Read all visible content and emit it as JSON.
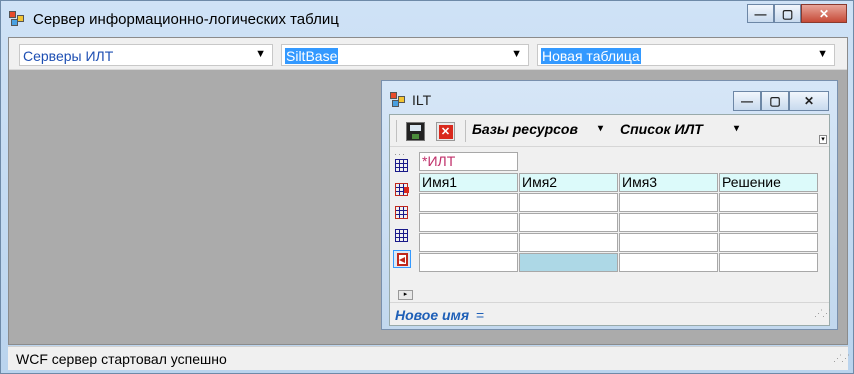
{
  "main_window": {
    "title": "Сервер информационно-логических таблиц",
    "caption_buttons": {
      "minimize": "—",
      "maximize": "▢",
      "close": "✕"
    }
  },
  "toolbar": {
    "combos": [
      {
        "value": "Серверы ИЛТ",
        "selected": false
      },
      {
        "value": "SiltBase",
        "selected": true
      },
      {
        "value": "Новая таблица",
        "selected": true
      }
    ],
    "dropdown_arrow": "▼"
  },
  "status_bar": {
    "text": "WCF сервер стартовал успешно"
  },
  "child_window": {
    "title": "ILT",
    "caption_buttons": {
      "minimize": "—",
      "maximize": "▢",
      "close": "✕"
    },
    "toolbar": {
      "save_icon": "save-icon",
      "delete_icon": "delete-icon",
      "delete_glyph": "✕",
      "resources_combo": "Базы ресурсов",
      "list_combo": "Список ИЛТ",
      "dropdown_arrow": "▾",
      "overflow_glyph": "▾"
    },
    "side_tools": [
      "add-column-icon",
      "add-row-icon",
      "insert-column-icon",
      "insert-row-icon",
      "exit-icon"
    ],
    "table": {
      "name": "*ИЛТ",
      "columns": [
        "Имя1",
        "Имя2",
        "Имя3",
        "Решение"
      ],
      "rows": [
        [
          "",
          "",
          "",
          ""
        ],
        [
          "",
          "",
          "",
          ""
        ],
        [
          "",
          "",
          "",
          ""
        ],
        [
          "",
          "",
          "",
          ""
        ]
      ],
      "selected_cell": "row 4, column 2"
    },
    "hscroll_glyph": "▸",
    "status": {
      "label": "Новое имя",
      "equals": "="
    }
  },
  "colors": {
    "accent_blue": "#1e4fb3",
    "selection": "#3399ff",
    "header_fill": "#dcfafa",
    "name_text": "#c0306a",
    "selected_cell": "#add8e6",
    "close_button": "#c64a37"
  }
}
